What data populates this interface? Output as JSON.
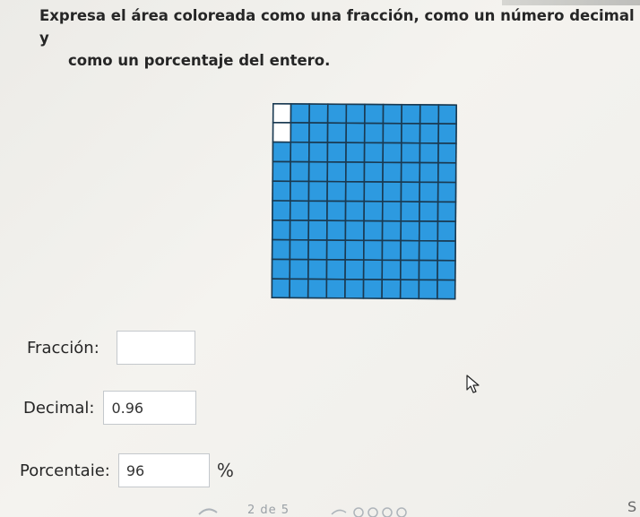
{
  "question": {
    "line1": "Expresa el área coloreada como una fracción, como un número decimal y",
    "line2": "como un porcentaje del entero."
  },
  "grid": {
    "rows": 10,
    "cols": 10,
    "unshaded_cells": 2,
    "shaded_fraction": 0.96,
    "fill_color": "#2d9ae0",
    "line_color": "#1a3a52",
    "empty_color": "#ffffff"
  },
  "fields": {
    "fraction": {
      "label": "Fracción:",
      "value": ""
    },
    "decimal": {
      "label": "Decimal:",
      "value": "0.96"
    },
    "percent": {
      "label": "Porcentaie:",
      "value": "96",
      "suffix": "%"
    }
  },
  "footer": {
    "pager_text": "2 de 5",
    "corner_text": "S"
  },
  "icons": {
    "cursor": "mouse-pointer-icon",
    "progress_dots": "progress-dots-icon"
  }
}
